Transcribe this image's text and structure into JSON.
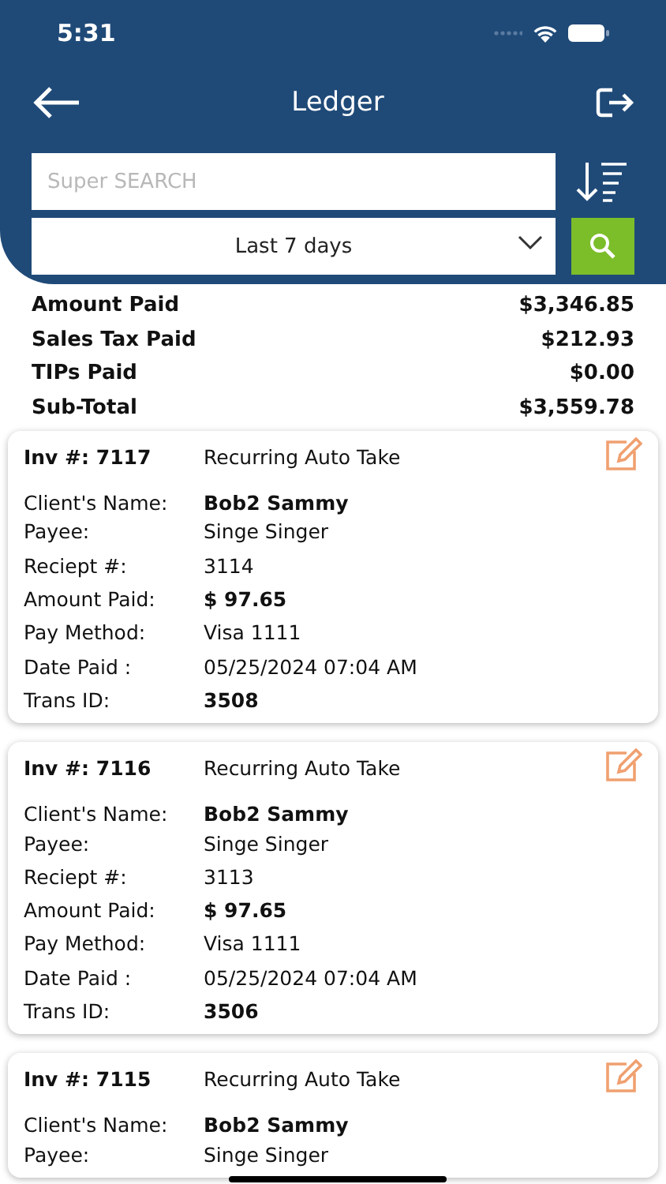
{
  "status_bar": {
    "time": "5:31"
  },
  "header": {
    "title": "Ledger"
  },
  "search": {
    "placeholder": "Super SEARCH"
  },
  "period": {
    "value": "Last 7 days"
  },
  "summary": [
    {
      "label": "Amount Paid",
      "value": "$3,346.85"
    },
    {
      "label": "Sales Tax Paid",
      "value": "$212.93"
    },
    {
      "label": "TIPs Paid",
      "value": "$0.00"
    },
    {
      "label": "Sub-Total",
      "value": "$3,559.78"
    }
  ],
  "payments": [
    {
      "invoice_label": "Inv #: 7117",
      "type": "Recurring Auto Take",
      "fields": [
        {
          "label": "Client's Name:",
          "value": "Bob2 Sammy",
          "bold": true
        },
        {
          "label": "Payee:",
          "value": "Singe Singer",
          "bold": false
        },
        {
          "label": "Reciept #:",
          "value": "3114",
          "bold": false
        },
        {
          "label": "Amount Paid:",
          "value": "$ 97.65",
          "bold": true
        },
        {
          "label": "Pay Method:",
          "value": "Visa 1111",
          "bold": false
        },
        {
          "label": "Date Paid :",
          "value": "05/25/2024 07:04 AM",
          "bold": false
        },
        {
          "label": "Trans ID:",
          "value": "3508",
          "bold": true
        }
      ]
    },
    {
      "invoice_label": "Inv #: 7116",
      "type": "Recurring Auto Take",
      "fields": [
        {
          "label": "Client's Name:",
          "value": "Bob2 Sammy",
          "bold": true
        },
        {
          "label": "Payee:",
          "value": "Singe Singer",
          "bold": false
        },
        {
          "label": "Reciept #:",
          "value": "3113",
          "bold": false
        },
        {
          "label": "Amount Paid:",
          "value": "$ 97.65",
          "bold": true
        },
        {
          "label": "Pay Method:",
          "value": "Visa 1111",
          "bold": false
        },
        {
          "label": "Date Paid :",
          "value": "05/25/2024 07:04 AM",
          "bold": false
        },
        {
          "label": "Trans ID:",
          "value": "3506",
          "bold": true
        }
      ]
    },
    {
      "invoice_label": "Inv #: 7115",
      "type": "Recurring Auto Take",
      "fields": [
        {
          "label": "Client's Name:",
          "value": "Bob2 Sammy",
          "bold": true
        },
        {
          "label": "Payee:",
          "value": "Singe Singer",
          "bold": false
        }
      ]
    }
  ]
}
